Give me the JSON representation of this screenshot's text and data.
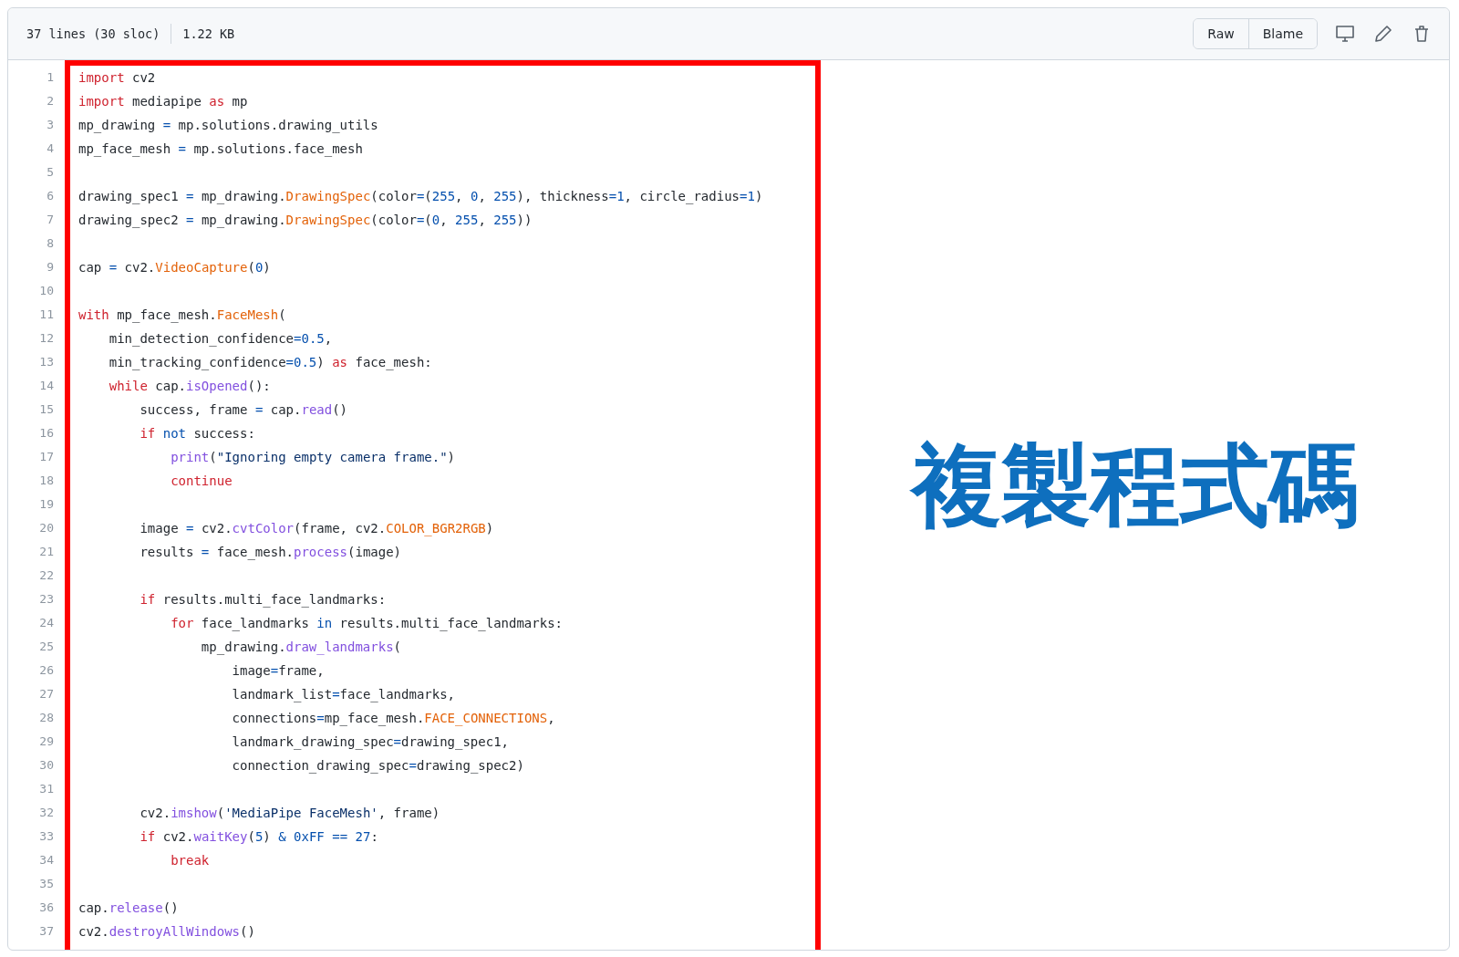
{
  "file_header": {
    "line_count": "37 lines (30 sloc)",
    "file_size": "1.22 KB",
    "buttons": [
      "Raw",
      "Blame"
    ]
  },
  "code_lines": [
    {
      "num": "1",
      "tokens": [
        {
          "text": "import",
          "kind": "kw"
        },
        {
          "text": " cv2",
          "kind": "plain"
        }
      ]
    },
    {
      "num": "2",
      "tokens": [
        {
          "text": "import",
          "kind": "kw"
        },
        {
          "text": " mediapipe ",
          "kind": "plain"
        },
        {
          "text": "as",
          "kind": "kw"
        },
        {
          "text": " mp",
          "kind": "plain"
        }
      ]
    },
    {
      "num": "3",
      "tokens": [
        {
          "text": "mp_drawing ",
          "kind": "plain"
        },
        {
          "text": "=",
          "kind": "op"
        },
        {
          "text": " mp.solutions.drawing_utils",
          "kind": "plain"
        }
      ]
    },
    {
      "num": "4",
      "tokens": [
        {
          "text": "mp_face_mesh ",
          "kind": "plain"
        },
        {
          "text": "=",
          "kind": "op"
        },
        {
          "text": " mp.solutions.face_mesh",
          "kind": "plain"
        }
      ]
    },
    {
      "num": "5"
    },
    {
      "num": "6",
      "tokens": [
        {
          "text": "drawing_spec1 ",
          "kind": "plain"
        },
        {
          "text": "=",
          "kind": "op"
        },
        {
          "text": " mp_drawing.",
          "kind": "plain"
        },
        {
          "text": "DrawingSpec",
          "kind": "cls"
        },
        {
          "text": "(color",
          "kind": "plain"
        },
        {
          "text": "=",
          "kind": "op"
        },
        {
          "text": "(",
          "kind": "plain"
        },
        {
          "text": "255",
          "kind": "num"
        },
        {
          "text": ", ",
          "kind": "plain"
        },
        {
          "text": "0",
          "kind": "num"
        },
        {
          "text": ", ",
          "kind": "plain"
        },
        {
          "text": "255",
          "kind": "num"
        },
        {
          "text": "), thickness",
          "kind": "plain"
        },
        {
          "text": "=",
          "kind": "op"
        },
        {
          "text": "1",
          "kind": "num"
        },
        {
          "text": ", circle_radius",
          "kind": "plain"
        },
        {
          "text": "=",
          "kind": "op"
        },
        {
          "text": "1",
          "kind": "num"
        },
        {
          "text": ")",
          "kind": "plain"
        }
      ]
    },
    {
      "num": "7",
      "tokens": [
        {
          "text": "drawing_spec2 ",
          "kind": "plain"
        },
        {
          "text": "=",
          "kind": "op"
        },
        {
          "text": " mp_drawing.",
          "kind": "plain"
        },
        {
          "text": "DrawingSpec",
          "kind": "cls"
        },
        {
          "text": "(color",
          "kind": "plain"
        },
        {
          "text": "=",
          "kind": "op"
        },
        {
          "text": "(",
          "kind": "plain"
        },
        {
          "text": "0",
          "kind": "num"
        },
        {
          "text": ", ",
          "kind": "plain"
        },
        {
          "text": "255",
          "kind": "num"
        },
        {
          "text": ", ",
          "kind": "plain"
        },
        {
          "text": "255",
          "kind": "num"
        },
        {
          "text": "))",
          "kind": "plain"
        }
      ]
    },
    {
      "num": "8"
    },
    {
      "num": "9",
      "tokens": [
        {
          "text": "cap ",
          "kind": "plain"
        },
        {
          "text": "=",
          "kind": "op"
        },
        {
          "text": " cv2.",
          "kind": "plain"
        },
        {
          "text": "VideoCapture",
          "kind": "cls"
        },
        {
          "text": "(",
          "kind": "plain"
        },
        {
          "text": "0",
          "kind": "num"
        },
        {
          "text": ")",
          "kind": "plain"
        }
      ]
    },
    {
      "num": "10"
    },
    {
      "num": "11",
      "tokens": [
        {
          "text": "with",
          "kind": "kw"
        },
        {
          "text": " mp_face_mesh.",
          "kind": "plain"
        },
        {
          "text": "FaceMesh",
          "kind": "cls"
        },
        {
          "text": "(",
          "kind": "plain"
        }
      ]
    },
    {
      "num": "12",
      "tokens": [
        {
          "text": "    min_detection_confidence",
          "kind": "plain"
        },
        {
          "text": "=",
          "kind": "op"
        },
        {
          "text": "0.5",
          "kind": "num"
        },
        {
          "text": ",",
          "kind": "plain"
        }
      ]
    },
    {
      "num": "13",
      "tokens": [
        {
          "text": "    min_tracking_confidence",
          "kind": "plain"
        },
        {
          "text": "=",
          "kind": "op"
        },
        {
          "text": "0.5",
          "kind": "num"
        },
        {
          "text": ") ",
          "kind": "plain"
        },
        {
          "text": "as",
          "kind": "kw"
        },
        {
          "text": " face_mesh:",
          "kind": "plain"
        }
      ]
    },
    {
      "num": "14",
      "tokens": [
        {
          "text": "    while",
          "kind": "kw"
        },
        {
          "text": " cap.",
          "kind": "plain"
        },
        {
          "text": "isOpened",
          "kind": "fn"
        },
        {
          "text": "():",
          "kind": "plain"
        }
      ]
    },
    {
      "num": "15",
      "tokens": [
        {
          "text": "        success, frame ",
          "kind": "plain"
        },
        {
          "text": "=",
          "kind": "op"
        },
        {
          "text": " cap.",
          "kind": "plain"
        },
        {
          "text": "read",
          "kind": "fn"
        },
        {
          "text": "()",
          "kind": "plain"
        }
      ]
    },
    {
      "num": "16",
      "tokens": [
        {
          "text": "        if",
          "kind": "kw"
        },
        {
          "text": " not",
          "kind": "op"
        },
        {
          "text": " success:",
          "kind": "plain"
        }
      ]
    },
    {
      "num": "17",
      "tokens": [
        {
          "text": "            print",
          "kind": "fn"
        },
        {
          "text": "(",
          "kind": "plain"
        },
        {
          "text": "\"Ignoring empty camera frame.\"",
          "kind": "str"
        },
        {
          "text": ")",
          "kind": "plain"
        }
      ]
    },
    {
      "num": "18",
      "tokens": [
        {
          "text": "            continue",
          "kind": "kw"
        }
      ]
    },
    {
      "num": "19"
    },
    {
      "num": "20",
      "tokens": [
        {
          "text": "        image ",
          "kind": "plain"
        },
        {
          "text": "=",
          "kind": "op"
        },
        {
          "text": " cv2.",
          "kind": "plain"
        },
        {
          "text": "cvtColor",
          "kind": "fn"
        },
        {
          "text": "(frame, cv2.",
          "kind": "plain"
        },
        {
          "text": "COLOR_BGR2RGB",
          "kind": "cls"
        },
        {
          "text": ")",
          "kind": "plain"
        }
      ]
    },
    {
      "num": "21",
      "tokens": [
        {
          "text": "        results ",
          "kind": "plain"
        },
        {
          "text": "=",
          "kind": "op"
        },
        {
          "text": " face_mesh.",
          "kind": "plain"
        },
        {
          "text": "process",
          "kind": "fn"
        },
        {
          "text": "(image)",
          "kind": "plain"
        }
      ]
    },
    {
      "num": "22"
    },
    {
      "num": "23",
      "tokens": [
        {
          "text": "        if",
          "kind": "kw"
        },
        {
          "text": " results.multi_face_landmarks:",
          "kind": "plain"
        }
      ]
    },
    {
      "num": "24",
      "tokens": [
        {
          "text": "            for",
          "kind": "kw"
        },
        {
          "text": " face_landmarks ",
          "kind": "plain"
        },
        {
          "text": "in",
          "kind": "op"
        },
        {
          "text": " results.multi_face_landmarks:",
          "kind": "plain"
        }
      ]
    },
    {
      "num": "25",
      "tokens": [
        {
          "text": "                mp_drawing.",
          "kind": "plain"
        },
        {
          "text": "draw_landmarks",
          "kind": "fn"
        },
        {
          "text": "(",
          "kind": "plain"
        }
      ]
    },
    {
      "num": "26",
      "tokens": [
        {
          "text": "                    image",
          "kind": "plain"
        },
        {
          "text": "=",
          "kind": "op"
        },
        {
          "text": "frame,",
          "kind": "plain"
        }
      ]
    },
    {
      "num": "27",
      "tokens": [
        {
          "text": "                    landmark_list",
          "kind": "plain"
        },
        {
          "text": "=",
          "kind": "op"
        },
        {
          "text": "face_landmarks,",
          "kind": "plain"
        }
      ]
    },
    {
      "num": "28",
      "tokens": [
        {
          "text": "                    connections",
          "kind": "plain"
        },
        {
          "text": "=",
          "kind": "op"
        },
        {
          "text": "mp_face_mesh.",
          "kind": "plain"
        },
        {
          "text": "FACE_CONNECTIONS",
          "kind": "cls"
        },
        {
          "text": ",",
          "kind": "plain"
        }
      ]
    },
    {
      "num": "29",
      "tokens": [
        {
          "text": "                    landmark_drawing_spec",
          "kind": "plain"
        },
        {
          "text": "=",
          "kind": "op"
        },
        {
          "text": "drawing_spec1,",
          "kind": "plain"
        }
      ]
    },
    {
      "num": "30",
      "tokens": [
        {
          "text": "                    connection_drawing_spec",
          "kind": "plain"
        },
        {
          "text": "=",
          "kind": "op"
        },
        {
          "text": "drawing_spec2)",
          "kind": "plain"
        }
      ]
    },
    {
      "num": "31"
    },
    {
      "num": "32",
      "tokens": [
        {
          "text": "        cv2.",
          "kind": "plain"
        },
        {
          "text": "imshow",
          "kind": "fn"
        },
        {
          "text": "(",
          "kind": "plain"
        },
        {
          "text": "'MediaPipe FaceMesh'",
          "kind": "str"
        },
        {
          "text": ", frame)",
          "kind": "plain"
        }
      ]
    },
    {
      "num": "33",
      "tokens": [
        {
          "text": "        if",
          "kind": "kw"
        },
        {
          "text": " cv2.",
          "kind": "plain"
        },
        {
          "text": "waitKey",
          "kind": "fn"
        },
        {
          "text": "(",
          "kind": "plain"
        },
        {
          "text": "5",
          "kind": "num"
        },
        {
          "text": ") ",
          "kind": "plain"
        },
        {
          "text": "&",
          "kind": "op"
        },
        {
          "text": " 0xFF",
          "kind": "num"
        },
        {
          "text": " ==",
          "kind": "op"
        },
        {
          "text": " 27",
          "kind": "num"
        },
        {
          "text": ":",
          "kind": "plain"
        }
      ]
    },
    {
      "num": "34",
      "tokens": [
        {
          "text": "            break",
          "kind": "kw"
        }
      ]
    },
    {
      "num": "35"
    },
    {
      "num": "36",
      "tokens": [
        {
          "text": "cap.",
          "kind": "plain"
        },
        {
          "text": "release",
          "kind": "fn"
        },
        {
          "text": "()",
          "kind": "plain"
        }
      ]
    },
    {
      "num": "37",
      "tokens": [
        {
          "text": "cv2.",
          "kind": "plain"
        },
        {
          "text": "destroyAllWindows",
          "kind": "fn"
        },
        {
          "text": "()",
          "kind": "plain"
        }
      ]
    }
  ],
  "caption": "複製程式碼"
}
